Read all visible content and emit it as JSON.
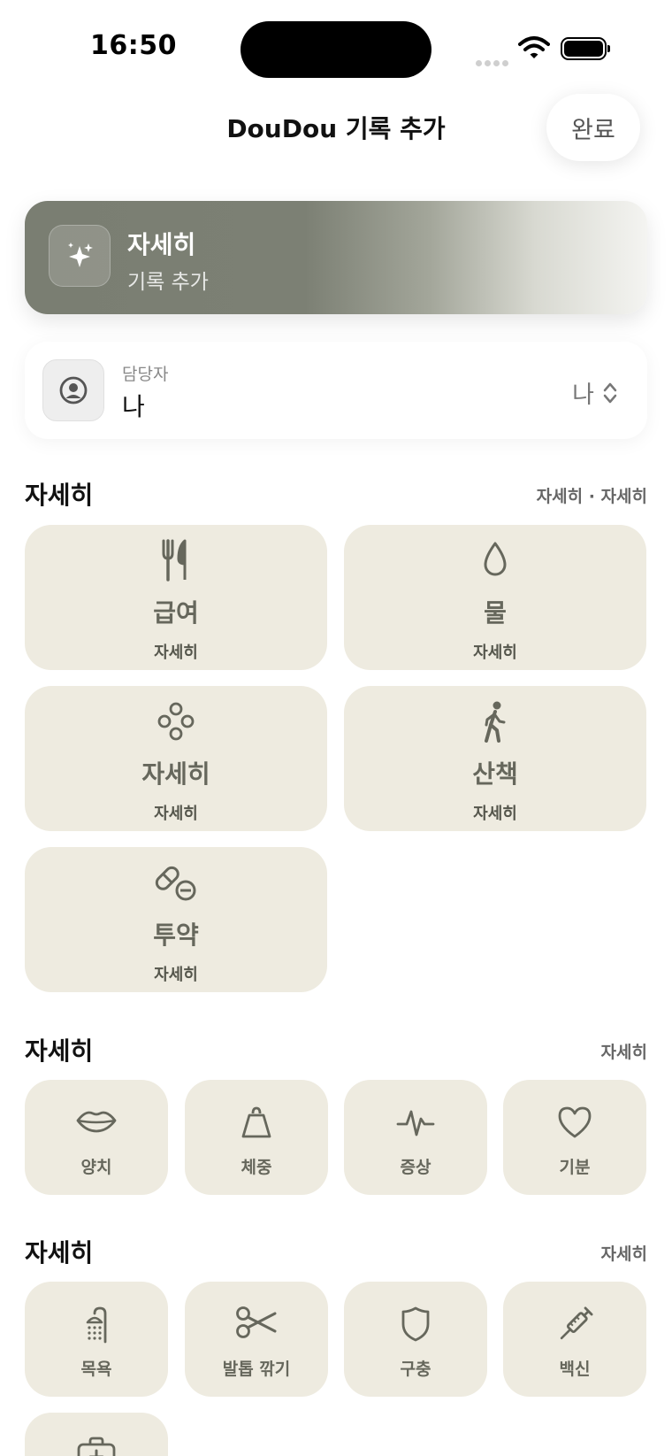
{
  "status": {
    "time": "16:50"
  },
  "nav": {
    "title": "DouDou 기록 추가",
    "done_label": "완료"
  },
  "hero": {
    "title": "자세히",
    "subtitle": "기록 추가",
    "icon": "sparkles-icon"
  },
  "assignee": {
    "label": "담당자",
    "name": "나",
    "picker_value": "나",
    "icon": "person-circle-icon"
  },
  "section1": {
    "title": "자세히",
    "meta": "자세히 · 자세히",
    "tiles": [
      {
        "title": "급여",
        "subtitle": "자세히",
        "icon": "fork-knife-icon"
      },
      {
        "title": "물",
        "subtitle": "자세히",
        "icon": "drop-icon"
      },
      {
        "title": "자세히",
        "subtitle": "자세히",
        "icon": "circles-icon"
      },
      {
        "title": "산책",
        "subtitle": "자세히",
        "icon": "walk-icon"
      },
      {
        "title": "투약",
        "subtitle": "자세히",
        "icon": "pills-icon"
      }
    ]
  },
  "section2": {
    "title": "자세히",
    "meta": "자세히",
    "tiles": [
      {
        "title": "양치",
        "icon": "mouth-icon"
      },
      {
        "title": "체중",
        "icon": "scale-icon"
      },
      {
        "title": "증상",
        "icon": "waveform-icon"
      },
      {
        "title": "기분",
        "icon": "heart-icon"
      }
    ]
  },
  "section3": {
    "title": "자세히",
    "meta": "자세히",
    "tiles": [
      {
        "title": "목욕",
        "icon": "shower-icon"
      },
      {
        "title": "발톱 깎기",
        "icon": "scissors-icon"
      },
      {
        "title": "구충",
        "icon": "shield-icon"
      },
      {
        "title": "백신",
        "icon": "syringe-icon"
      },
      {
        "title": "",
        "icon": "medical-bag-icon"
      }
    ]
  },
  "colors": {
    "tile_bg": "#eeebe0",
    "icon": "#66675c",
    "hero_dark": "#7a7e72"
  }
}
